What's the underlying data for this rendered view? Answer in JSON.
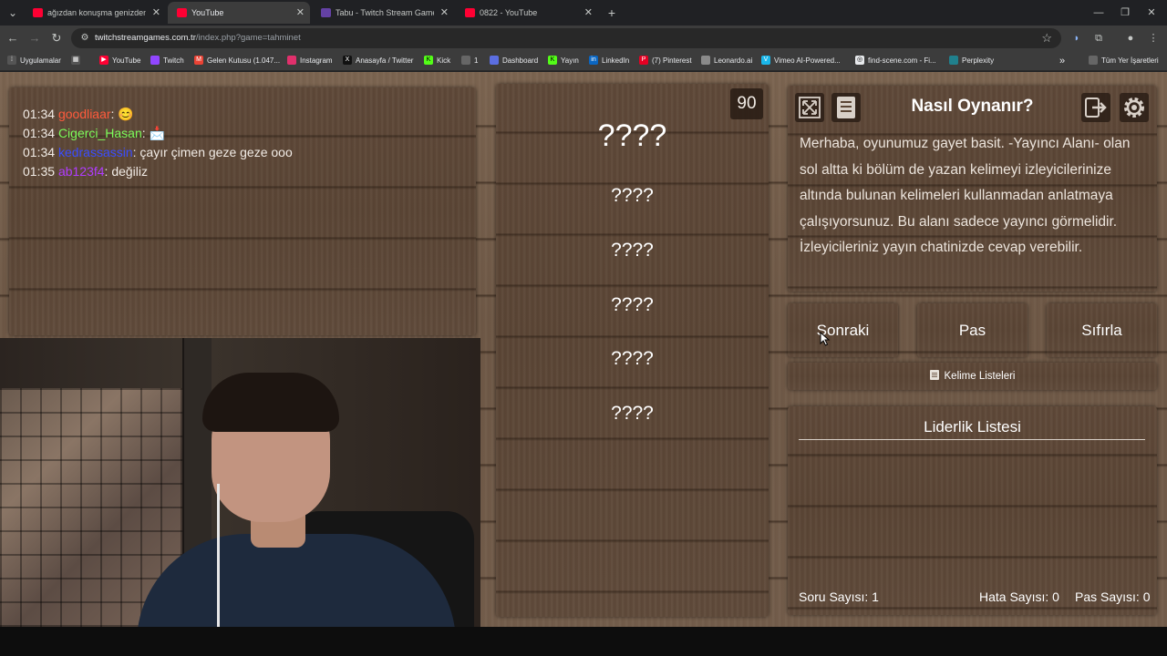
{
  "browser": {
    "tabs": [
      {
        "title": "ağızdan konuşma genizden kon",
        "favicon_color": "#ff0033",
        "active": false
      },
      {
        "title": "YouTube",
        "favicon_color": "#ff0033",
        "active": true
      },
      {
        "title": "Tabu - Twitch Stream Games",
        "favicon_color": "#6441a5",
        "active": false
      },
      {
        "title": "0822 - YouTube",
        "favicon_color": "#ff0033",
        "active": false
      }
    ],
    "url_host": "twitchstreamgames.com.tr",
    "url_path": "/index.php?game=tahminet",
    "bookmarks": [
      {
        "label": "Uygulamalar",
        "icon": "apps-icon",
        "color": "#c4c7c5"
      },
      {
        "label": "YouTube",
        "icon": "youtube-icon",
        "color": "#ff0033"
      },
      {
        "label": "Twitch",
        "icon": "twitch-icon",
        "color": "#9146ff"
      },
      {
        "label": "Gelen Kutusu (1.047...",
        "icon": "gmail-icon",
        "color": "#ea4335"
      },
      {
        "label": "Instagram",
        "icon": "instagram-icon",
        "color": "#e1306c"
      },
      {
        "label": "Anasayfa / Twitter",
        "icon": "x-icon",
        "color": "#111111"
      },
      {
        "label": "Kick",
        "icon": "kick-icon",
        "color": "#53fc18"
      },
      {
        "label": "1",
        "icon": "folder-icon",
        "color": "#c4c7c5"
      },
      {
        "label": "Dashboard",
        "icon": "dashboard-icon",
        "color": "#5b6ee1"
      },
      {
        "label": "Yayın",
        "icon": "kick-icon",
        "color": "#53fc18"
      },
      {
        "label": "LinkedIn",
        "icon": "linkedin-icon",
        "color": "#0a66c2"
      },
      {
        "label": "(7) Pinterest",
        "icon": "pinterest-icon",
        "color": "#e60023"
      },
      {
        "label": "Leonardo.ai",
        "icon": "leonardo-icon",
        "color": "#8a8a8a"
      },
      {
        "label": "Vimeo AI-Powered...",
        "icon": "vimeo-icon",
        "color": "#1ab7ea"
      },
      {
        "label": "find-scene.com - Fi...",
        "icon": "find-scene-icon",
        "color": "#e8eaed"
      },
      {
        "label": "Perplexity",
        "icon": "perplexity-icon",
        "color": "#20808d"
      }
    ],
    "all_bookmarks": "Tüm Yer İşaretleri"
  },
  "chat": {
    "messages": [
      {
        "time": "01:34",
        "user": "goodliaar",
        "user_color": "#ff5a3c",
        "text": ": 😊"
      },
      {
        "time": "01:34",
        "user": "Cigerci_Hasan",
        "user_color": "#7cfc5a",
        "text": ": 📩"
      },
      {
        "time": "01:34",
        "user": "kedrassassin",
        "user_color": "#3a4cff",
        "text": ": çayır çimen geze geze ooo"
      },
      {
        "time": "01:35",
        "user": "ab123f4",
        "user_color": "#b03cff",
        "text": ": değiliz"
      }
    ]
  },
  "game": {
    "timer": "90",
    "main_word": "????",
    "taboo_words": [
      "????",
      "????",
      "????",
      "????",
      "????"
    ],
    "howto_title": "Nasıl Oynanır?",
    "howto_text": "Merhaba, oyunumuz gayet basit. -Yayıncı Alanı- olan sol altta ki bölüm de yazan kelimeyi izleyicilerinize altında bulunan kelimeleri kullanmadan anlatmaya çalışıyorsunuz. Bu alanı sadece yayıncı görmelidir. İzleyicileriniz yayın chatinizde cevap verebilir.",
    "buttons": {
      "next": "Sonraki",
      "pass": "Pas",
      "reset": "Sıfırla"
    },
    "word_lists": "Kelime Listeleri",
    "leaderboard_title": "Liderlik Listesi",
    "stats": {
      "questions": "Soru Sayısı: 1",
      "errors": "Hata Sayısı: 0",
      "passes": "Pas Sayısı: 0"
    }
  }
}
